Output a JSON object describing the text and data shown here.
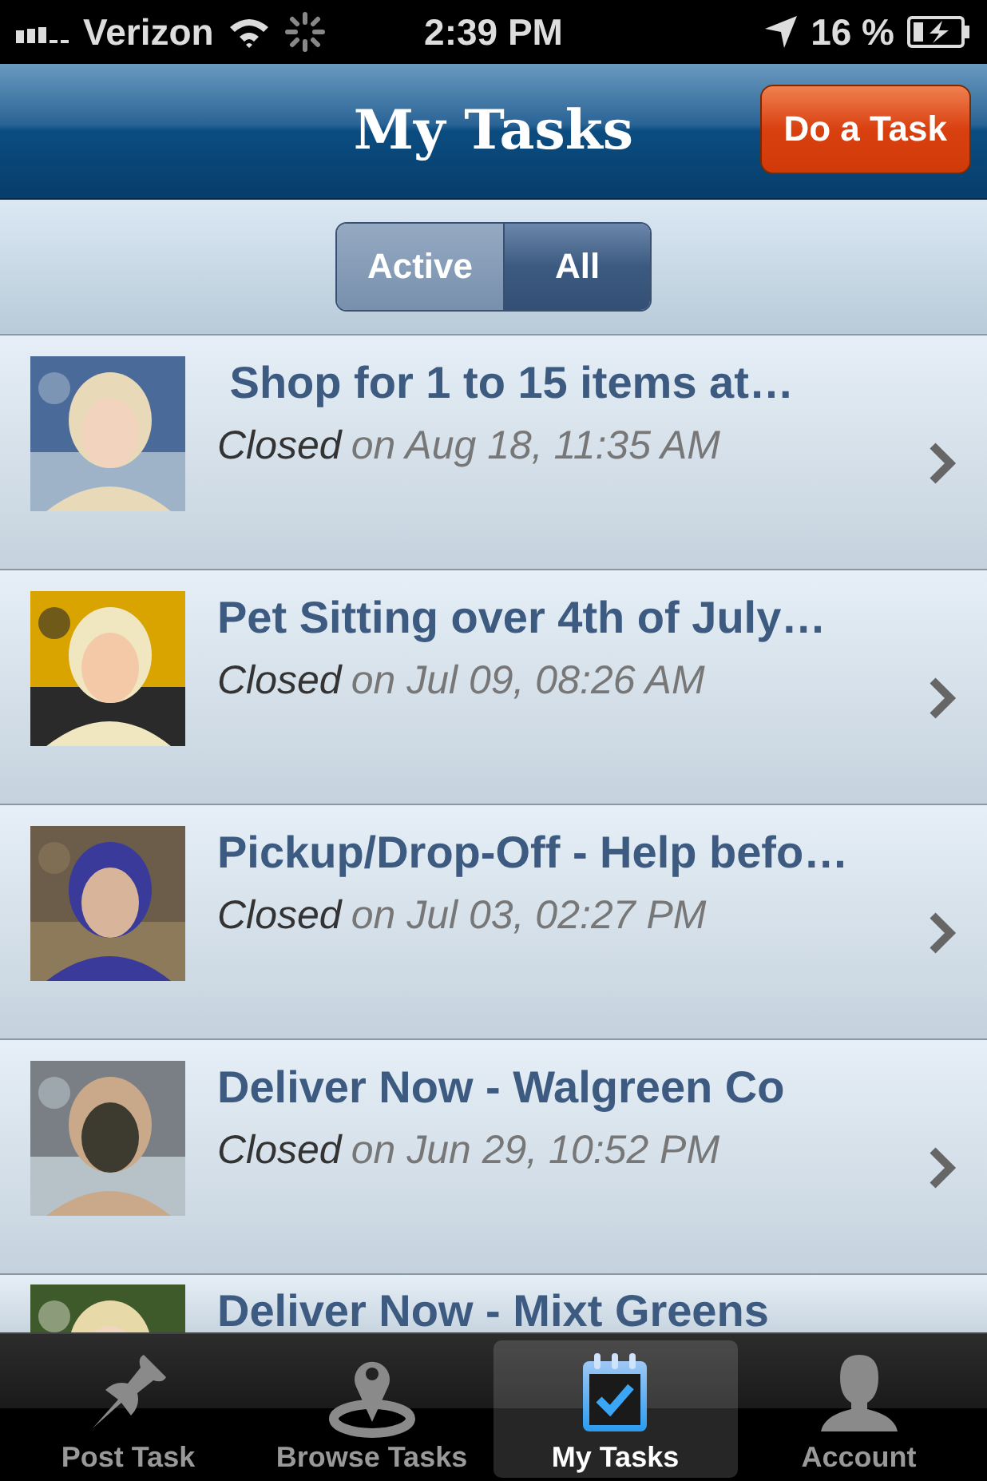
{
  "status_bar": {
    "carrier": "Verizon",
    "time": "2:39 PM",
    "battery": "16 %"
  },
  "nav": {
    "title": "My Tasks",
    "action": "Do a Task"
  },
  "segments": [
    {
      "label": "Active",
      "selected": false
    },
    {
      "label": "All",
      "selected": true
    }
  ],
  "tasks": [
    {
      "title": " Shop for 1 to 15 items at…",
      "status": "Closed",
      "date": "on Aug 18, 11:35 AM"
    },
    {
      "title": "Pet Sitting over 4th of July…",
      "status": "Closed",
      "date": "on Jul 09, 08:26 AM"
    },
    {
      "title": "Pickup/Drop-Off - Help befo…",
      "status": "Closed",
      "date": "on Jul 03, 02:27 PM"
    },
    {
      "title": "Deliver Now - Walgreen Co",
      "status": "Closed",
      "date": "on Jun 29, 10:52 PM"
    },
    {
      "title": "Deliver Now - Mixt Greens"
    }
  ],
  "tab_bar": [
    {
      "label": "Post Task",
      "kind": "pin",
      "selected": false
    },
    {
      "label": "Browse Tasks",
      "kind": "location",
      "selected": false
    },
    {
      "label": "My Tasks",
      "kind": "calendar",
      "selected": true
    },
    {
      "label": "Account",
      "kind": "person",
      "selected": false
    }
  ]
}
